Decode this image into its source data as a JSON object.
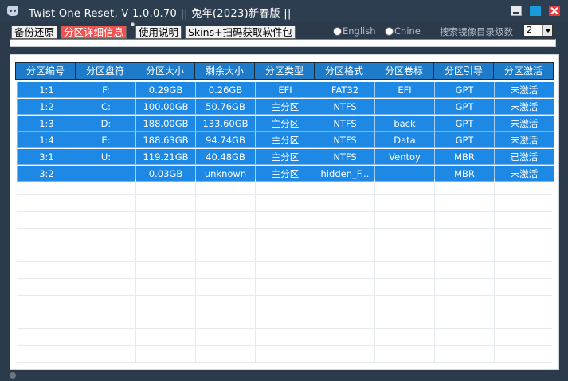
{
  "window": {
    "title": "Twist One Reset,  V 1.0.0.70    ||  兔年(2023)新春版  ||"
  },
  "tabs": [
    {
      "label": "备份还原",
      "active": false
    },
    {
      "label": "分区详细信息",
      "active": true
    },
    {
      "label": "使用说明",
      "active": false
    },
    {
      "label": "Skins+扫码获取软件包",
      "active": false
    }
  ],
  "language": {
    "english": "English",
    "chinese": "Chine"
  },
  "search": {
    "label": "搜索镜像目录级数",
    "level_value": "2"
  },
  "table": {
    "columns": [
      "分区编号",
      "分区盘符",
      "分区大小",
      "剩余大小",
      "分区类型",
      "分区格式",
      "分区卷标",
      "分区引导",
      "分区激活"
    ],
    "rows": [
      [
        "1:1",
        "F:",
        "0.29GB",
        "0.26GB",
        "EFI",
        "FAT32",
        "EFI",
        "GPT",
        "未激活"
      ],
      [
        "1:2",
        "C:",
        "100.00GB",
        "50.76GB",
        "主分区",
        "NTFS",
        "",
        "GPT",
        "未激活"
      ],
      [
        "1:3",
        "D:",
        "188.00GB",
        "133.60GB",
        "主分区",
        "NTFS",
        "back",
        "GPT",
        "未激活"
      ],
      [
        "1:4",
        "E:",
        "188.63GB",
        "94.74GB",
        "主分区",
        "NTFS",
        "Data",
        "GPT",
        "未激活"
      ],
      [
        "3:1",
        "U:",
        "119.21GB",
        "40.48GB",
        "主分区",
        "NTFS",
        "Ventoy",
        "MBR",
        "已激活"
      ],
      [
        "3:2",
        "",
        "0.03GB",
        "unknown",
        "主分区",
        "hidden_F...",
        "",
        "MBR",
        "未激活"
      ]
    ]
  },
  "colors": {
    "titlebar": "#2d3e50",
    "selected_row": "#1e88e5",
    "header": "#1e7bc9",
    "active_tab": "#ef5350"
  },
  "icons": [
    "app-icon",
    "minimize-icon",
    "maximize-icon",
    "close-icon",
    "dropdown-arrow-icon"
  ]
}
